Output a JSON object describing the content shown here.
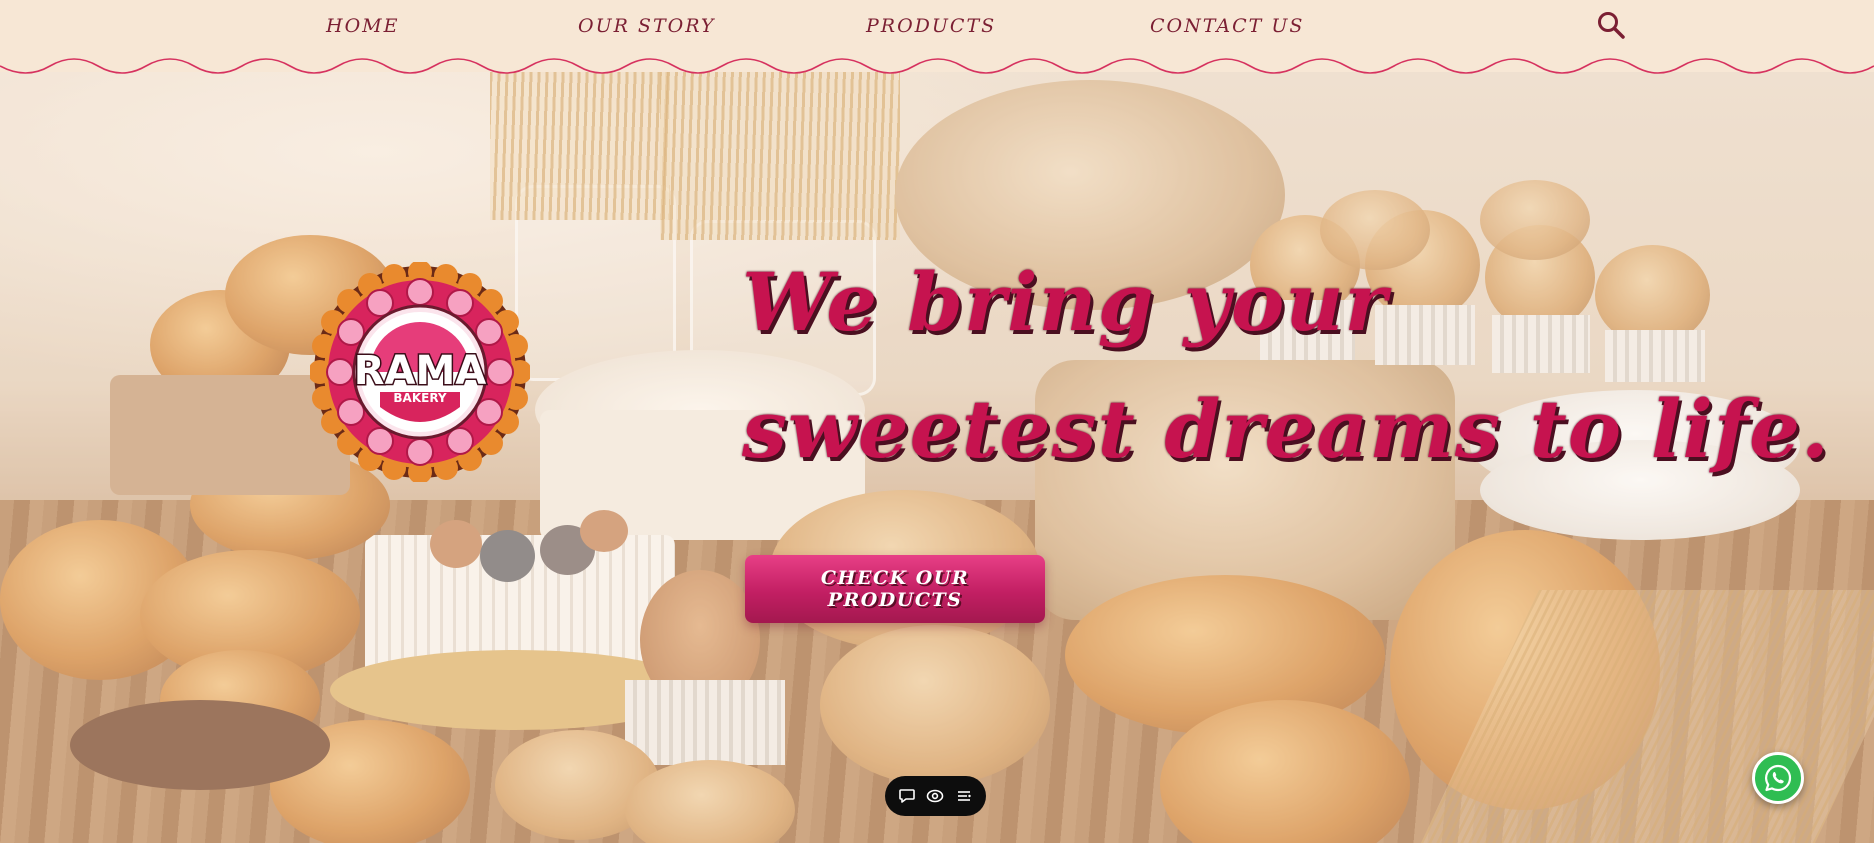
{
  "nav": {
    "items": [
      {
        "label": "HOME"
      },
      {
        "label": "OUR STORY"
      },
      {
        "label": "PRODUCTS"
      },
      {
        "label": "CONTACT US"
      }
    ],
    "search_icon": "search-icon"
  },
  "logo": {
    "name": "RAMA",
    "subtitle": "BAKERY"
  },
  "hero": {
    "line1": "We bring your",
    "line2": "sweetest dreams to life.",
    "cta_label": "CHECK OUR PRODUCTS"
  },
  "toolbar": {
    "icons": [
      "comment-icon",
      "eye-icon",
      "menu-lines-icon"
    ]
  },
  "floating": {
    "whatsapp_icon": "whatsapp-icon"
  },
  "colors": {
    "accent": "#c6134f",
    "nav_text": "#7b1f33",
    "header_bg": "#f7e7d5",
    "cta_top": "#e83f86",
    "cta_bottom": "#a4184f",
    "whatsapp": "#2fbd52"
  }
}
